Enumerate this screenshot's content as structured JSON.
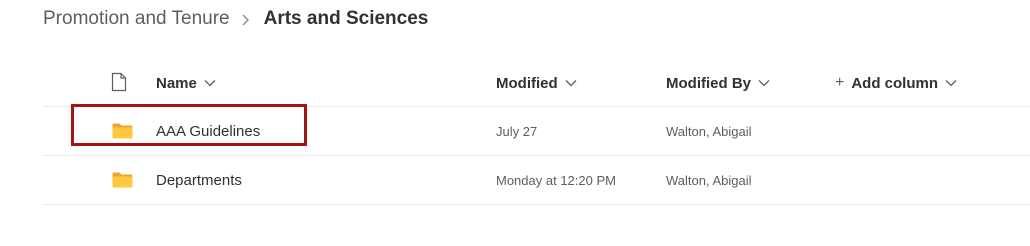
{
  "breadcrumb": {
    "parent": "Promotion and Tenure",
    "separator_icon": "chevron-right-icon",
    "current": "Arts and Sciences"
  },
  "columns": {
    "file_type_icon": "document-icon",
    "name": "Name",
    "modified": "Modified",
    "modified_by": "Modified By",
    "add_column": "Add column",
    "sort_icon": "chevron-down-icon",
    "add_icon": "+"
  },
  "rows": [
    {
      "icon": "folder-icon",
      "name": "AAA Guidelines",
      "modified": "July 27",
      "modified_by": "Walton, Abigail",
      "highlighted": true
    },
    {
      "icon": "folder-icon",
      "name": "Departments",
      "modified": "Monday at 12:20 PM",
      "modified_by": "Walton, Abigail",
      "highlighted": false
    }
  ],
  "colors": {
    "folder": "#FFC83D",
    "folder_back": "#E8A82B",
    "highlight_box": "#A31515",
    "divider": "#EDEBE9"
  }
}
